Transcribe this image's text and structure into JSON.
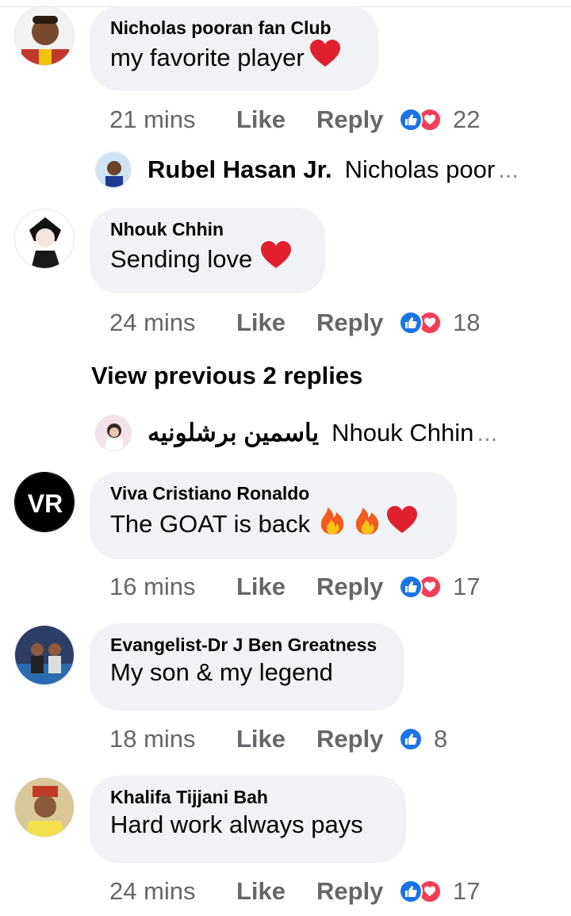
{
  "comments": [
    {
      "author": "Nicholas pooran fan Club",
      "text": "my favorite player",
      "emojis": [
        "heart"
      ],
      "time": "21 mins",
      "like_label": "Like",
      "reply_label": "Reply",
      "reactions": [
        "like",
        "love"
      ],
      "reaction_count": "22"
    },
    {
      "author": "Nhouk Chhin",
      "text": "Sending love",
      "emojis": [
        "heart"
      ],
      "time": "24 mins",
      "like_label": "Like",
      "reply_label": "Reply",
      "reactions": [
        "like",
        "love"
      ],
      "reaction_count": "18"
    },
    {
      "author": "Viva Cristiano Ronaldo",
      "text": "The GOAT is back",
      "emojis": [
        "fire",
        "fire",
        "heart"
      ],
      "time": "16 mins",
      "like_label": "Like",
      "reply_label": "Reply",
      "reactions": [
        "like",
        "love"
      ],
      "reaction_count": "17"
    },
    {
      "author": "Evangelist-Dr J Ben Greatness",
      "text": "My son & my legend",
      "emojis": [],
      "time": "18 mins",
      "like_label": "Like",
      "reply_label": "Reply",
      "reactions": [
        "like"
      ],
      "reaction_count": "8"
    },
    {
      "author": "Khalifa Tijjani Bah",
      "text": "Hard work always pays",
      "emojis": [],
      "time": "24 mins",
      "like_label": "Like",
      "reply_label": "Reply",
      "reactions": [
        "like",
        "love"
      ],
      "reaction_count": "17"
    }
  ],
  "reply_previews": [
    {
      "name": "Rubel Hasan Jr.",
      "text": "Nicholas poor",
      "ellipsis": "..."
    },
    {
      "name": "ياسمين برشلونيه",
      "text": "Nhouk Chhin",
      "ellipsis": "..."
    }
  ],
  "view_previous_label": "View previous 2 replies",
  "colors": {
    "bubble": "#f0f2f5",
    "secondary_text": "#65676b",
    "like_blue": "#1b74e4",
    "love_red": "#f33e58"
  }
}
